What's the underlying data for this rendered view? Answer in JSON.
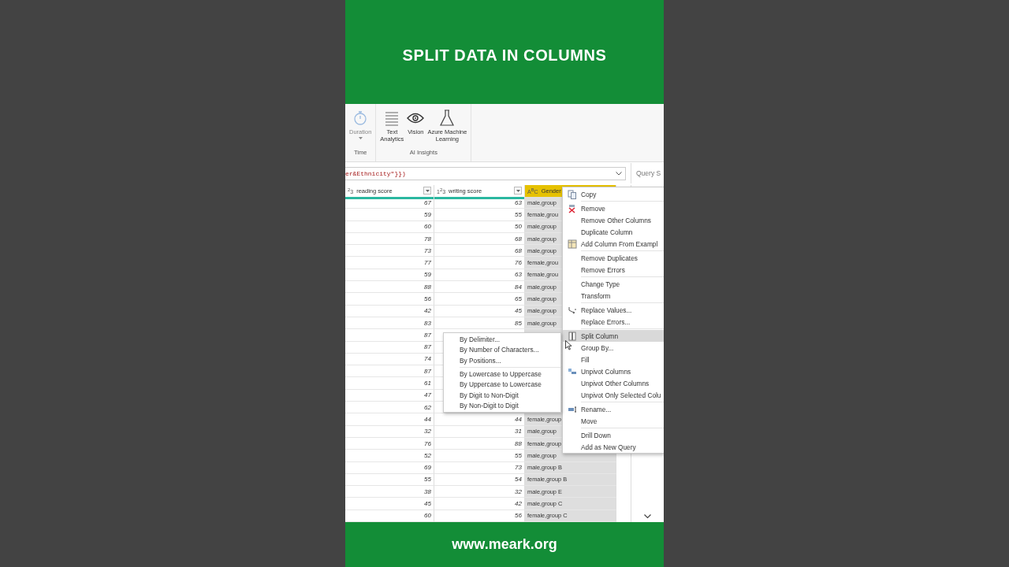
{
  "header": {
    "title": "SPLIT DATA IN COLUMNS"
  },
  "ribbon": {
    "groups": [
      {
        "label": "Time",
        "buttons": [
          {
            "label": "Duration",
            "disabled": true,
            "dropdown": true
          }
        ]
      },
      {
        "label": "AI Insights",
        "buttons": [
          {
            "label": "Text\nAnalytics",
            "disabled": false,
            "dropdown": false
          },
          {
            "label": "Vision",
            "disabled": false,
            "dropdown": false
          },
          {
            "label": "Azure Machine\nLearning",
            "disabled": false,
            "dropdown": false
          }
        ]
      }
    ]
  },
  "formula_bar": {
    "text": "er&Ethnicity\"}})"
  },
  "query_panel": {
    "title": "Query S"
  },
  "grid": {
    "columns": [
      {
        "type": "$^{2}$3",
        "name": "reading score",
        "selected": false
      },
      {
        "type": "1$^{2}$3",
        "name": "writing score",
        "selected": false
      },
      {
        "type": "A$^{B}$C",
        "name": "Gender",
        "selected": true
      }
    ],
    "rows": [
      {
        "reading": "67",
        "writing": "63",
        "gender": "male,group"
      },
      {
        "reading": "59",
        "writing": "55",
        "gender": "female,grou"
      },
      {
        "reading": "60",
        "writing": "50",
        "gender": "male,group"
      },
      {
        "reading": "78",
        "writing": "68",
        "gender": "male,group"
      },
      {
        "reading": "73",
        "writing": "68",
        "gender": "male,group"
      },
      {
        "reading": "77",
        "writing": "76",
        "gender": "female,grou"
      },
      {
        "reading": "59",
        "writing": "63",
        "gender": "female,grou"
      },
      {
        "reading": "88",
        "writing": "84",
        "gender": "male,group"
      },
      {
        "reading": "56",
        "writing": "65",
        "gender": "male,group"
      },
      {
        "reading": "42",
        "writing": "45",
        "gender": "male,group"
      },
      {
        "reading": "83",
        "writing": "85",
        "gender": "male,group"
      },
      {
        "reading": "87"
      },
      {
        "reading": "87"
      },
      {
        "reading": "74"
      },
      {
        "reading": "87"
      },
      {
        "reading": "61"
      },
      {
        "reading": "47"
      },
      {
        "reading": "62"
      },
      {
        "reading": "44",
        "writing": "44",
        "gender": "female,group"
      },
      {
        "reading": "32",
        "writing": "31",
        "gender": "male,group"
      },
      {
        "reading": "76",
        "writing": "88",
        "gender": "female,group"
      },
      {
        "reading": "52",
        "writing": "55",
        "gender": "male,group"
      },
      {
        "reading": "69",
        "writing": "73",
        "gender": "male,group B"
      },
      {
        "reading": "55",
        "writing": "54",
        "gender": "female,group B"
      },
      {
        "reading": "38",
        "writing": "32",
        "gender": "male,group E"
      },
      {
        "reading": "45",
        "writing": "42",
        "gender": "male,group C"
      },
      {
        "reading": "60",
        "writing": "56",
        "gender": "female,group C"
      }
    ]
  },
  "context_menu": {
    "groups": [
      [
        {
          "label": "Copy",
          "selected": false
        }
      ],
      [
        {
          "label": "Remove",
          "selected": false
        },
        {
          "label": "Remove Other Columns",
          "selected": false
        },
        {
          "label": "Duplicate Column",
          "selected": false
        },
        {
          "label": "Add Column From Exampl",
          "selected": false
        }
      ],
      [
        {
          "label": "Remove Duplicates",
          "selected": false
        },
        {
          "label": "Remove Errors",
          "selected": false
        }
      ],
      [
        {
          "label": "Change Type",
          "selected": false
        },
        {
          "label": "Transform",
          "selected": false
        }
      ],
      [
        {
          "label": "Replace Values...",
          "selected": false
        },
        {
          "label": "Replace Errors...",
          "selected": false
        }
      ],
      [
        {
          "label": "Split Column",
          "selected": true
        },
        {
          "label": "Group By...",
          "selected": false
        },
        {
          "label": "Fill",
          "selected": false
        },
        {
          "label": "Unpivot Columns",
          "selected": false
        },
        {
          "label": "Unpivot Other Columns",
          "selected": false
        },
        {
          "label": "Unpivot Only Selected Colu",
          "selected": false
        }
      ],
      [
        {
          "label": "Rename...",
          "selected": false
        },
        {
          "label": "Move",
          "selected": false
        }
      ],
      [
        {
          "label": "Drill Down",
          "selected": false
        },
        {
          "label": "Add as New Query",
          "selected": false
        }
      ]
    ]
  },
  "split_submenu": {
    "groups": [
      [
        "By Delimiter...",
        "By Number of Characters...",
        "By Positions..."
      ],
      [
        "By Lowercase to Uppercase",
        "By Uppercase to Lowercase",
        "By Digit to Non-Digit",
        "By Non-Digit to Digit"
      ]
    ]
  },
  "footer": {
    "text": "www.meark.org"
  }
}
